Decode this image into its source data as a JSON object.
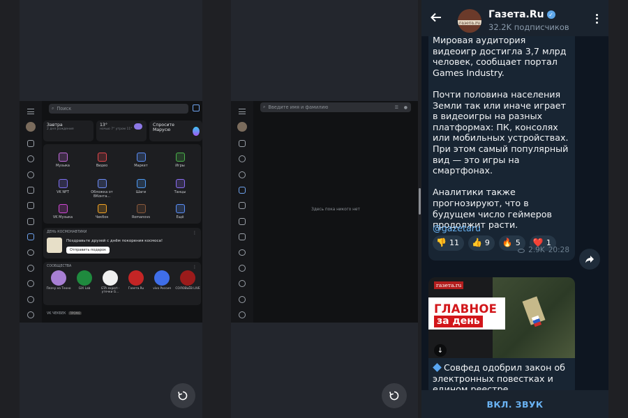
{
  "card1": {
    "search_placeholder": "Поиск",
    "widgets": {
      "tomorrow_title": "Завтра",
      "tomorrow_sub": "2 дня рождения",
      "weather_temp": "13°",
      "weather_sub": "ночью 7° утром 11°",
      "marusia_title": "Спросите Марусю"
    },
    "apps": [
      {
        "label": "Музыка",
        "color": "#c36bde"
      },
      {
        "label": "Видео",
        "color": "#e5484d"
      },
      {
        "label": "Маркет",
        "color": "#5b8ff9"
      },
      {
        "label": "Игры",
        "color": "#4bb34b"
      },
      {
        "label": "VK NFT",
        "color": "#7d6ff0"
      },
      {
        "label": "Обложка от ВКонта...",
        "color": "#6d8cf6"
      },
      {
        "label": "Шаги",
        "color": "#4f9bf5"
      },
      {
        "label": "Танцы",
        "color": "#8b6ef3"
      },
      {
        "label": "VK Музыка",
        "color": "#d148d6"
      },
      {
        "label": "Чекбок",
        "color": "#f5a524"
      },
      {
        "label": "Romanovs",
        "color": "#8b5a3c"
      },
      {
        "label": "Ещё",
        "color": "#5b8ff9"
      }
    ],
    "space": {
      "caption": "ДЕНЬ КОСМОНАВТИКИ",
      "text": "Поздравьте друзей с днём покорения космоса!",
      "button": "Отправить подарок"
    },
    "communities": {
      "caption": "СООБЩЕСТВА",
      "items": [
        {
          "label": "Плачу на Техно",
          "color": "#a77fd3"
        },
        {
          "label": "GIX Lab",
          "color": "#1f8a3e"
        },
        {
          "label": "GTA expert - утечки G...",
          "color": "#f0f0f0"
        },
        {
          "label": "Газета.Ru",
          "color": "#c42525"
        },
        {
          "label": "vivo Россия",
          "color": "#3f6ee8"
        },
        {
          "label": "СОЛОВЬЁВ LIVE",
          "color": "#9b1b1b"
        }
      ]
    },
    "vk_bot": {
      "caption": "VK ЧЕКБЕК",
      "badge": "ПРОМО"
    }
  },
  "card2": {
    "search_placeholder": "Введите имя и фамилию",
    "empty_text": "Здесь пока никого нет"
  },
  "telegram": {
    "channel_name": "Газета.Ru",
    "subscribers": "32.2K подписчиков",
    "avatar_text": "газета.ru",
    "message_paragraphs": [
      "Мировая аудитория видеоигр достигла 3,7 млрд человек, сообщает портал Games Industry.",
      "Почти половина населения Земли так или иначе играет в видеоигры на разных платформах: ПК, консолях или мобильных устройствах. При этом самый популярный вид — это игры на смартфонах.",
      "Аналитики также прогнозируют, что в будущем число геймеров продолжит расти."
    ],
    "hashtag": "@gazetaru",
    "reactions": [
      {
        "emoji": "👎",
        "count": "11"
      },
      {
        "emoji": "👍",
        "count": "9"
      },
      {
        "emoji": "🔥",
        "count": "5"
      },
      {
        "emoji": "❤️",
        "count": "1"
      }
    ],
    "views": "2.9K",
    "time": "20:28",
    "next_post": {
      "brand": "газета.ru",
      "headline_1": "ГЛАВНОЕ",
      "headline_2": "за день",
      "caption": "Совфед одобрил закон об электронных повестках и едином реестре"
    },
    "unmute_label": "ВКЛ. ЗВУК"
  }
}
